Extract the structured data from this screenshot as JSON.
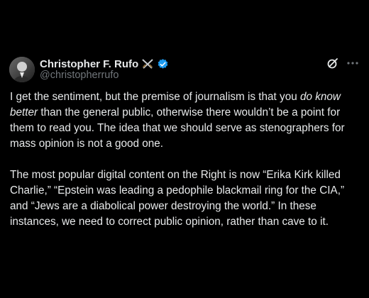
{
  "author": {
    "name": "Christopher F. Rufo",
    "emoji_icon": "crossed-swords-icon",
    "verified_icon": "verified-badge-icon",
    "verified_color": "#1d9bf0",
    "handle": "@christopherrufo"
  },
  "actions": {
    "grok_icon": "grok-icon",
    "more_icon": "more-icon"
  },
  "tweet": {
    "p1": {
      "l1_a": "I get the sentiment, but the premise of journalism is that you ",
      "l1_em": "do know",
      "l2_em": "better",
      "l2_b": " than the general public, otherwise there wouldn’t be a point for",
      "l3": "them to read you. The idea that we should serve as stenographers for",
      "l4": "mass opinion is not a good one."
    },
    "p2": {
      "l1": "The most popular digital content on the Right is now “Erika Kirk killed",
      "l2": "Charlie,” “Epstein was leading a pedophile blackmail ring for the CIA,”",
      "l3": "and “Jews are a diabolical power destroying the world.” In these",
      "l4": "instances, we need to correct public opinion, rather than cave to it."
    }
  },
  "colors": {
    "background": "#000000",
    "text": "#e7e9ea",
    "secondary": "#71767b"
  }
}
